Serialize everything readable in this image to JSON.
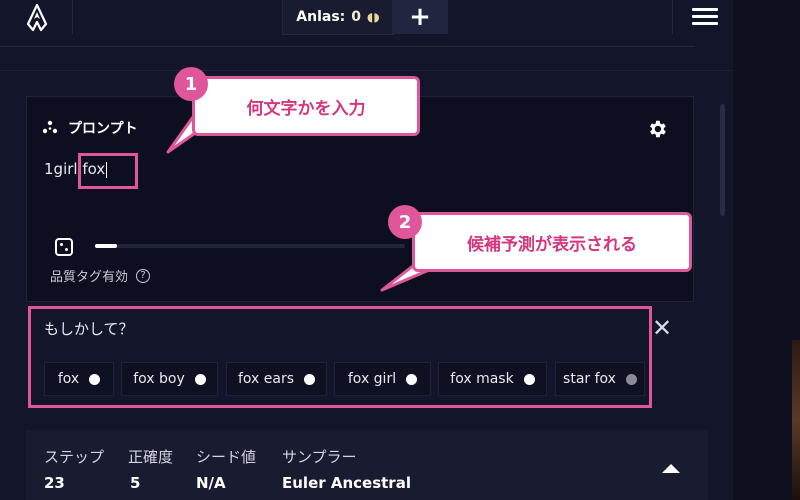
{
  "topbar": {
    "anlas_label": "Anlas:",
    "anlas_value": "0",
    "anlas_coin": "◖◗",
    "plus": "+"
  },
  "prompt": {
    "title": "プロンプト",
    "text_prefix": "1girl ",
    "text_typed": "fox",
    "quality_label": "品質タグ有効",
    "help": "?"
  },
  "suggestions": {
    "title": "もしかして？",
    "close": "✕",
    "items": [
      {
        "label": "fox"
      },
      {
        "label": "fox boy"
      },
      {
        "label": "fox ears"
      },
      {
        "label": "fox girl"
      },
      {
        "label": "fox mask"
      },
      {
        "label": "star fox"
      }
    ]
  },
  "settings": {
    "steps_label": "ステップ",
    "steps_value": "23",
    "guidance_label": "正確度",
    "guidance_value": "5",
    "seed_label": "シード値",
    "seed_value": "N/A",
    "sampler_label": "サンプラー",
    "sampler_value": "Euler Ancestral"
  },
  "annotations": {
    "badge1": "1",
    "callout1": "何文字かを入力",
    "badge2": "2",
    "callout2": "候補予測が表示される"
  },
  "colors": {
    "accent_pink": "#e0569a",
    "panel_bg": "#0d0f20",
    "page_bg": "#13152a"
  }
}
